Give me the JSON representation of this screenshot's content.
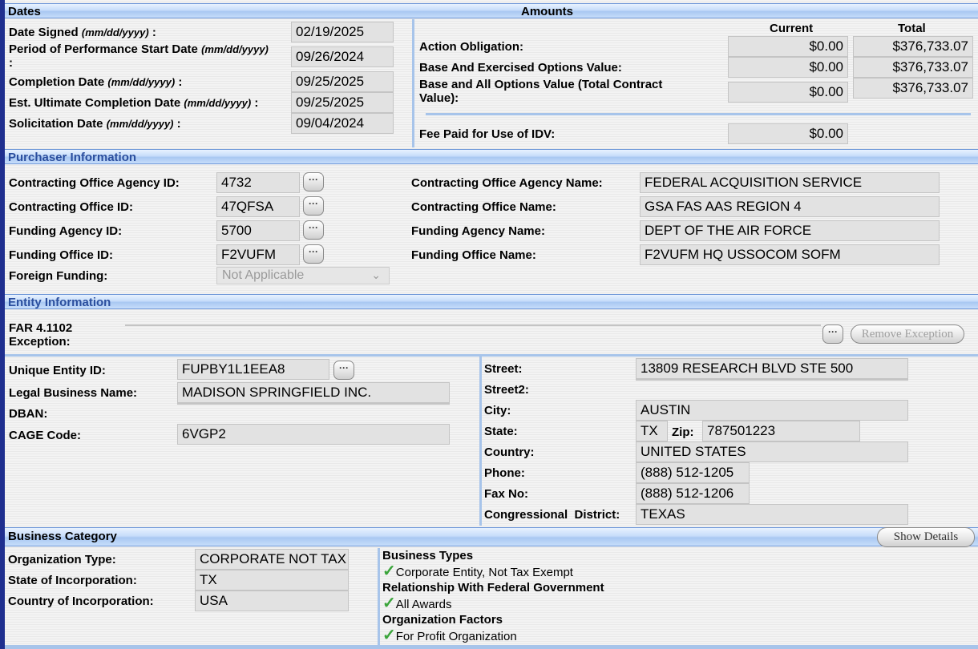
{
  "dates": {
    "header": "Dates",
    "date_signed": {
      "label": "Date Signed",
      "fmt": "(mm/dd/yyyy)",
      "suffix": " :",
      "value": "02/19/2025"
    },
    "pop_start": {
      "label": "Period of Performance Start Date",
      "fmt": "(mm/dd/yyyy)",
      "suffix": ":",
      "value": "09/26/2024"
    },
    "completion": {
      "label": "Completion Date",
      "fmt": "(mm/dd/yyyy)",
      "suffix": " :",
      "value": "09/25/2025"
    },
    "est_ultimate": {
      "label": "Est. Ultimate Completion Date",
      "fmt": "(mm/dd/yyyy)",
      "suffix": " :",
      "value": "09/25/2025"
    },
    "solicitation": {
      "label": "Solicitation Date",
      "fmt": "(mm/dd/yyyy)",
      "suffix": " :",
      "value": "09/04/2024"
    }
  },
  "amounts": {
    "header": "Amounts",
    "col_current": "Current",
    "col_total": "Total",
    "action_obligation": {
      "label": "Action Obligation:",
      "current": "$0.00",
      "total": "$376,733.07"
    },
    "base_exercised": {
      "label": "Base And Exercised Options Value:",
      "current": "$0.00",
      "total": "$376,733.07"
    },
    "base_all": {
      "label_line1": "Base and All Options Value (Total Contract",
      "label_line2": "Value):",
      "current": "$0.00",
      "total": "$376,733.07"
    },
    "fee_paid": {
      "label": "Fee Paid for Use of IDV:",
      "current": "$0.00"
    }
  },
  "purchaser": {
    "header": "Purchaser Information",
    "agency_id": {
      "label": "Contracting Office Agency ID:",
      "value": "4732"
    },
    "office_id": {
      "label": "Contracting Office ID:",
      "value": "47QFSA"
    },
    "funding_agency_id": {
      "label": "Funding Agency ID:",
      "value": "5700"
    },
    "funding_office_id": {
      "label": "Funding Office ID:",
      "value": "F2VUFM"
    },
    "foreign_funding": {
      "label": "Foreign Funding:",
      "value": "Not Applicable"
    },
    "agency_name": {
      "label": "Contracting Office Agency Name:",
      "value": "FEDERAL ACQUISITION SERVICE"
    },
    "office_name": {
      "label": "Contracting Office Name:",
      "value": "GSA FAS AAS REGION 4"
    },
    "funding_agency_name": {
      "label": "Funding Agency Name:",
      "value": "DEPT OF THE AIR FORCE"
    },
    "funding_office_name": {
      "label": "Funding Office Name:",
      "value": "F2VUFM HQ USSOCOM SOFM"
    }
  },
  "entity": {
    "header": "Entity Information",
    "far_label_line1": "FAR 4.1102",
    "far_label_line2": "Exception:",
    "far_value": "",
    "remove_exception": "Remove Exception",
    "uei": {
      "label": "Unique Entity ID:",
      "value": "FUPBY1L1EEA8"
    },
    "legal_name": {
      "label": "Legal Business Name:",
      "value": "MADISON SPRINGFIELD INC."
    },
    "dban": {
      "label": "DBAN:",
      "value": ""
    },
    "cage": {
      "label": "CAGE Code:",
      "value": "6VGP2"
    },
    "street": {
      "label": "Street:",
      "value": "13809 RESEARCH BLVD STE 500"
    },
    "street2": {
      "label": "Street2:",
      "value": ""
    },
    "city": {
      "label": "City:",
      "value": "AUSTIN"
    },
    "state": {
      "label": "State:",
      "value": "TX"
    },
    "zip": {
      "label": "Zip:",
      "value": "787501223"
    },
    "country": {
      "label": "Country:",
      "value": "UNITED STATES"
    },
    "phone": {
      "label": "Phone:",
      "value": "(888) 512-1205"
    },
    "fax": {
      "label": "Fax No:",
      "value": "(888) 512-1206"
    },
    "district": {
      "label": "Congressional  District:",
      "value": "TEXAS"
    }
  },
  "business": {
    "header": "Business Category",
    "show_details": "Show Details",
    "org_type": {
      "label": "Organization Type:",
      "value": "CORPORATE NOT TAX EXEMPT"
    },
    "state_inc": {
      "label": "State of Incorporation:",
      "value": "TX"
    },
    "country_inc": {
      "label": "Country of Incorporation:",
      "value": "USA"
    },
    "business_types": {
      "title": "Business Types",
      "item": "Corporate Entity, Not Tax Exempt"
    },
    "relationship": {
      "title": "Relationship With Federal Government",
      "item": "All Awards"
    },
    "org_factors": {
      "title": "Organization Factors",
      "item": "For Profit Organization"
    },
    "check_glyph": "✓"
  }
}
